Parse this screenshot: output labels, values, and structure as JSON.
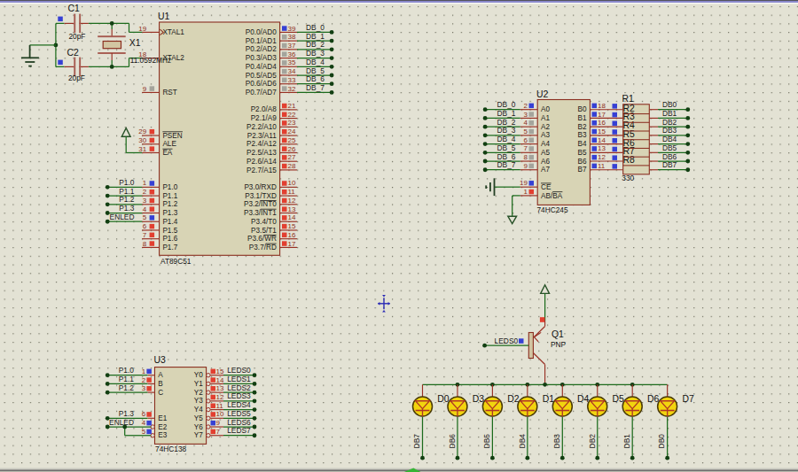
{
  "colors": {
    "canvas": "#e3e2d4",
    "grid_dot": "#6f6f5f",
    "chip_fill": "#d8d4b5",
    "chip_border": "#8a2e20",
    "pin_lead": "#982f23",
    "pin_number": "#8c2e21",
    "wire": "#1c6b1c",
    "terminal_dot": "#123f12",
    "label_text": "#111111",
    "state_red": "#e23f30",
    "state_blue": "#3640d4",
    "state_gray": "#a4a49c",
    "led_fill": "#f2d40e",
    "led_ring": "#4a3a08",
    "led_symbol": "#b03626",
    "titlebar": "#8a89cb",
    "cursor_green": "#35b535",
    "origin_cross": "#2b2bb5",
    "cap_plate": "#a65a50",
    "body_tan": "#d2c5a2",
    "window_edge": "#6e6e6e"
  },
  "u1": {
    "ref": "U1",
    "value": "AT89C51",
    "left_pins": [
      {
        "num": "19",
        "pre": "XTAL1",
        "ol": "",
        "sq": "",
        "net": ""
      },
      {
        "num": "18",
        "pre": "XTAL2",
        "ol": "",
        "sq": "",
        "net": ""
      },
      {
        "num": "9",
        "pre": "RST",
        "ol": "",
        "sq": "#a4a49c",
        "net": ""
      },
      {
        "num": "29",
        "pre": "",
        "ol": "PSEN",
        "sq": "#e23f30",
        "net": ""
      },
      {
        "num": "30",
        "pre": "ALE",
        "ol": "",
        "sq": "#e23f30",
        "net": ""
      },
      {
        "num": "31",
        "pre": "",
        "ol": "EA",
        "sq": "#e23f30",
        "net": ""
      },
      {
        "num": "1",
        "pre": "P1.0",
        "ol": "",
        "sq": "#3640d4",
        "net": "P1.0"
      },
      {
        "num": "2",
        "pre": "P1.1",
        "ol": "",
        "sq": "#e23f30",
        "net": "P1.1"
      },
      {
        "num": "3",
        "pre": "P1.2",
        "ol": "",
        "sq": "#e23f30",
        "net": "P1.2"
      },
      {
        "num": "4",
        "pre": "P1.3",
        "ol": "",
        "sq": "#e23f30",
        "net": "P1.3"
      },
      {
        "num": "5",
        "pre": "P1.4",
        "ol": "",
        "sq": "#3640d4",
        "net": "ENLED"
      },
      {
        "num": "6",
        "pre": "P1.5",
        "ol": "",
        "sq": "#e23f30",
        "net": ""
      },
      {
        "num": "7",
        "pre": "P1.6",
        "ol": "",
        "sq": "#e23f30",
        "net": ""
      },
      {
        "num": "8",
        "pre": "P1.7",
        "ol": "",
        "sq": "#e23f30",
        "net": ""
      }
    ],
    "right_pins": [
      {
        "num": "39",
        "pre": "P0.0/AD0",
        "ol": "",
        "sq": "#3640d4",
        "net": "DB_0"
      },
      {
        "num": "38",
        "pre": "P0.1/AD1",
        "ol": "",
        "sq": "#a4a49c",
        "net": "DB_1"
      },
      {
        "num": "37",
        "pre": "P0.2/AD2",
        "ol": "",
        "sq": "#a4a49c",
        "net": "DB_2"
      },
      {
        "num": "36",
        "pre": "P0.3/AD3",
        "ol": "",
        "sq": "#a4a49c",
        "net": "DB_3"
      },
      {
        "num": "35",
        "pre": "P0.4/AD4",
        "ol": "",
        "sq": "#a4a49c",
        "net": "DB_4"
      },
      {
        "num": "34",
        "pre": "P0.5/AD5",
        "ol": "",
        "sq": "#a4a49c",
        "net": "DB_5"
      },
      {
        "num": "33",
        "pre": "P0.6/AD6",
        "ol": "",
        "sq": "#a4a49c",
        "net": "DB_6"
      },
      {
        "num": "32",
        "pre": "P0.7/AD7",
        "ol": "",
        "sq": "#a4a49c",
        "net": "DB_7"
      },
      {
        "num": "21",
        "pre": "P2.0/A8",
        "ol": "",
        "sq": "#e23f30",
        "net": ""
      },
      {
        "num": "22",
        "pre": "P2.1/A9",
        "ol": "",
        "sq": "#e23f30",
        "net": ""
      },
      {
        "num": "23",
        "pre": "P2.2/A10",
        "ol": "",
        "sq": "#e23f30",
        "net": ""
      },
      {
        "num": "24",
        "pre": "P2.3/A11",
        "ol": "",
        "sq": "#e23f30",
        "net": ""
      },
      {
        "num": "25",
        "pre": "P2.4/A12",
        "ol": "",
        "sq": "#e23f30",
        "net": ""
      },
      {
        "num": "26",
        "pre": "P2.5/A13",
        "ol": "",
        "sq": "#e23f30",
        "net": ""
      },
      {
        "num": "27",
        "pre": "P2.6/A14",
        "ol": "",
        "sq": "#e23f30",
        "net": ""
      },
      {
        "num": "28",
        "pre": "P2.7/A15",
        "ol": "",
        "sq": "#e23f30",
        "net": ""
      },
      {
        "num": "10",
        "pre": "P3.0/RXD",
        "ol": "",
        "sq": "#e23f30",
        "net": ""
      },
      {
        "num": "11",
        "pre": "P3.1/TXD",
        "ol": "",
        "sq": "#e23f30",
        "net": ""
      },
      {
        "num": "12",
        "pre": "P3.2/",
        "ol": "INT0",
        "sq": "#e23f30",
        "net": ""
      },
      {
        "num": "13",
        "pre": "P3.3/",
        "ol": "INT1",
        "sq": "#e23f30",
        "net": ""
      },
      {
        "num": "14",
        "pre": "P3.4/T0",
        "ol": "",
        "sq": "#e23f30",
        "net": ""
      },
      {
        "num": "15",
        "pre": "P3.5/T1",
        "ol": "",
        "sq": "#e23f30",
        "net": ""
      },
      {
        "num": "16",
        "pre": "P3.6/",
        "ol": "WR",
        "sq": "#e23f30",
        "net": ""
      },
      {
        "num": "17",
        "pre": "P3.7/",
        "ol": "RD",
        "sq": "#e23f30",
        "net": ""
      }
    ]
  },
  "u2": {
    "ref": "U2",
    "value": "74HC245",
    "left_pins": [
      {
        "num": "2",
        "pre": "A0",
        "ol": "",
        "sq": "#3640d4",
        "net": "DB_0"
      },
      {
        "num": "3",
        "pre": "A1",
        "ol": "",
        "sq": "#a4a49c",
        "net": "DB_1"
      },
      {
        "num": "4",
        "pre": "A2",
        "ol": "",
        "sq": "#a4a49c",
        "net": "DB_2"
      },
      {
        "num": "5",
        "pre": "A3",
        "ol": "",
        "sq": "#a4a49c",
        "net": "DB_3"
      },
      {
        "num": "6",
        "pre": "A4",
        "ol": "",
        "sq": "#a4a49c",
        "net": "DB_4"
      },
      {
        "num": "7",
        "pre": "A5",
        "ol": "",
        "sq": "#a4a49c",
        "net": "DB_5"
      },
      {
        "num": "8",
        "pre": "A6",
        "ol": "",
        "sq": "#a4a49c",
        "net": "DB_6"
      },
      {
        "num": "9",
        "pre": "A7",
        "ol": "",
        "sq": "#a4a49c",
        "net": "DB_7"
      },
      {
        "num": "19",
        "pre": "",
        "ol": "CE",
        "sq": "#3640d4",
        "net": ""
      },
      {
        "num": "1",
        "pre": "AB/",
        "ol": "BA",
        "sq": "#e23f30",
        "net": ""
      }
    ],
    "right_pins": [
      {
        "num": "18",
        "pre": "B0",
        "ol": "",
        "sq": "#3640d4"
      },
      {
        "num": "17",
        "pre": "B1",
        "ol": "",
        "sq": "#3640d4"
      },
      {
        "num": "16",
        "pre": "B2",
        "ol": "",
        "sq": "#3640d4"
      },
      {
        "num": "15",
        "pre": "B3",
        "ol": "",
        "sq": "#3640d4"
      },
      {
        "num": "14",
        "pre": "B4",
        "ol": "",
        "sq": "#3640d4"
      },
      {
        "num": "13",
        "pre": "B5",
        "ol": "",
        "sq": "#3640d4"
      },
      {
        "num": "12",
        "pre": "B6",
        "ol": "",
        "sq": "#3640d4"
      },
      {
        "num": "11",
        "pre": "B7",
        "ol": "",
        "sq": "#3640d4"
      }
    ]
  },
  "u3": {
    "ref": "U3",
    "value": "74HC138",
    "left_pins": [
      {
        "num": "1",
        "pre": "A",
        "ol": "",
        "sq": "#3640d4",
        "net": "P1.0"
      },
      {
        "num": "2",
        "pre": "B",
        "ol": "",
        "sq": "#e23f30",
        "net": "P1.1"
      },
      {
        "num": "3",
        "pre": "C",
        "ol": "",
        "sq": "#e23f30",
        "net": "P1.2"
      },
      {
        "num": "6",
        "pre": "E1",
        "ol": "",
        "sq": "#e23f30",
        "net": "P1.3"
      },
      {
        "num": "4",
        "pre": "E2",
        "ol": "",
        "sq": "#3640d4",
        "net": "ENLED"
      },
      {
        "num": "5",
        "pre": "E3",
        "ol": "",
        "sq": "#3640d4",
        "net": ""
      }
    ],
    "right_pins": [
      {
        "num": "15",
        "pre": "Y0",
        "ol": "",
        "sq": "#e23f30",
        "net": "LEDS0"
      },
      {
        "num": "14",
        "pre": "Y1",
        "ol": "",
        "sq": "#e23f30",
        "net": "LEDS1"
      },
      {
        "num": "13",
        "pre": "Y2",
        "ol": "",
        "sq": "#e23f30",
        "net": "LEDS2"
      },
      {
        "num": "12",
        "pre": "Y3",
        "ol": "",
        "sq": "#e23f30",
        "net": "LEDS3"
      },
      {
        "num": "11",
        "pre": "Y4",
        "ol": "",
        "sq": "#e23f30",
        "net": "LEDS4"
      },
      {
        "num": "10",
        "pre": "Y5",
        "ol": "",
        "sq": "#e23f30",
        "net": "LEDS5"
      },
      {
        "num": "9",
        "pre": "Y6",
        "ol": "",
        "sq": "#3640d4",
        "net": "LEDS6"
      },
      {
        "num": "7",
        "pre": "Y7",
        "ol": "",
        "sq": "#e23f30",
        "net": "LEDS7"
      }
    ]
  },
  "r1": {
    "ref": "R1",
    "value": "330",
    "resistors": [
      "R2",
      "R3",
      "R4",
      "R5",
      "R6",
      "R7",
      "R8"
    ],
    "right_nets": [
      "DB0",
      "DB1",
      "DB2",
      "DB3",
      "DB4",
      "DB5",
      "DB6",
      "DB7"
    ]
  },
  "q1": {
    "ref": "Q1",
    "value": "PNP",
    "base_net": "LEDS0"
  },
  "x1": {
    "ref": "X1",
    "value": "11.0592MHz"
  },
  "c1": {
    "ref": "C1",
    "value": "20pF"
  },
  "c2": {
    "ref": "C2",
    "value": "20pF"
  },
  "leds": [
    {
      "ref": "D0",
      "net": "DB7"
    },
    {
      "ref": "D3",
      "net": "DB6"
    },
    {
      "ref": "D2",
      "net": "DB5"
    },
    {
      "ref": "D1",
      "net": "DB4"
    },
    {
      "ref": "D4",
      "net": "DB3"
    },
    {
      "ref": "D5",
      "net": "DB2"
    },
    {
      "ref": "D6",
      "net": "DB1"
    },
    {
      "ref": "D7",
      "net": "DB0"
    }
  ]
}
